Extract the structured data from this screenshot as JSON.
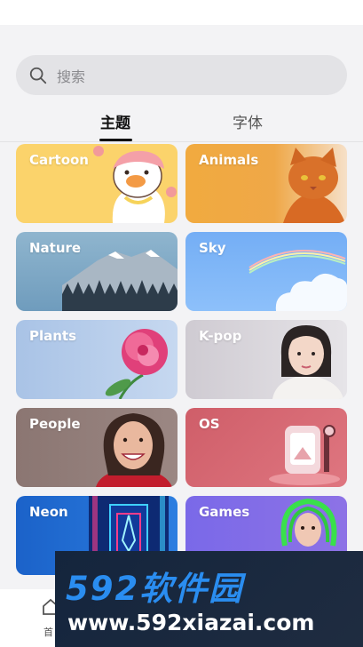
{
  "search": {
    "placeholder": "搜索"
  },
  "tabs": [
    {
      "label": "主题",
      "active": true
    },
    {
      "label": "字体",
      "active": false
    }
  ],
  "themes": [
    {
      "label": "Cartoon",
      "icon": "cartoon-duck-image"
    },
    {
      "label": "Animals",
      "icon": "cat-image"
    },
    {
      "label": "Nature",
      "icon": "mountain-image"
    },
    {
      "label": "Sky",
      "icon": "rainbow-cloud-image"
    },
    {
      "label": "Plants",
      "icon": "peony-flower-image"
    },
    {
      "label": "K-pop",
      "icon": "idol-portrait-image"
    },
    {
      "label": "People",
      "icon": "smiling-woman-image"
    },
    {
      "label": "OS",
      "icon": "3d-device-image"
    },
    {
      "label": "Neon",
      "icon": "neon-corridor-image"
    },
    {
      "label": "Games",
      "icon": "game-character-image"
    }
  ],
  "bottom_nav": {
    "home_label": "首"
  },
  "watermark": {
    "brand": "592软件园",
    "url": "www.592xiazai.com"
  },
  "colors": {
    "accent": "#111111",
    "search_bg": "#e3e3e6",
    "watermark_bg": "#14253d",
    "watermark_brand": "#2a8df0"
  }
}
